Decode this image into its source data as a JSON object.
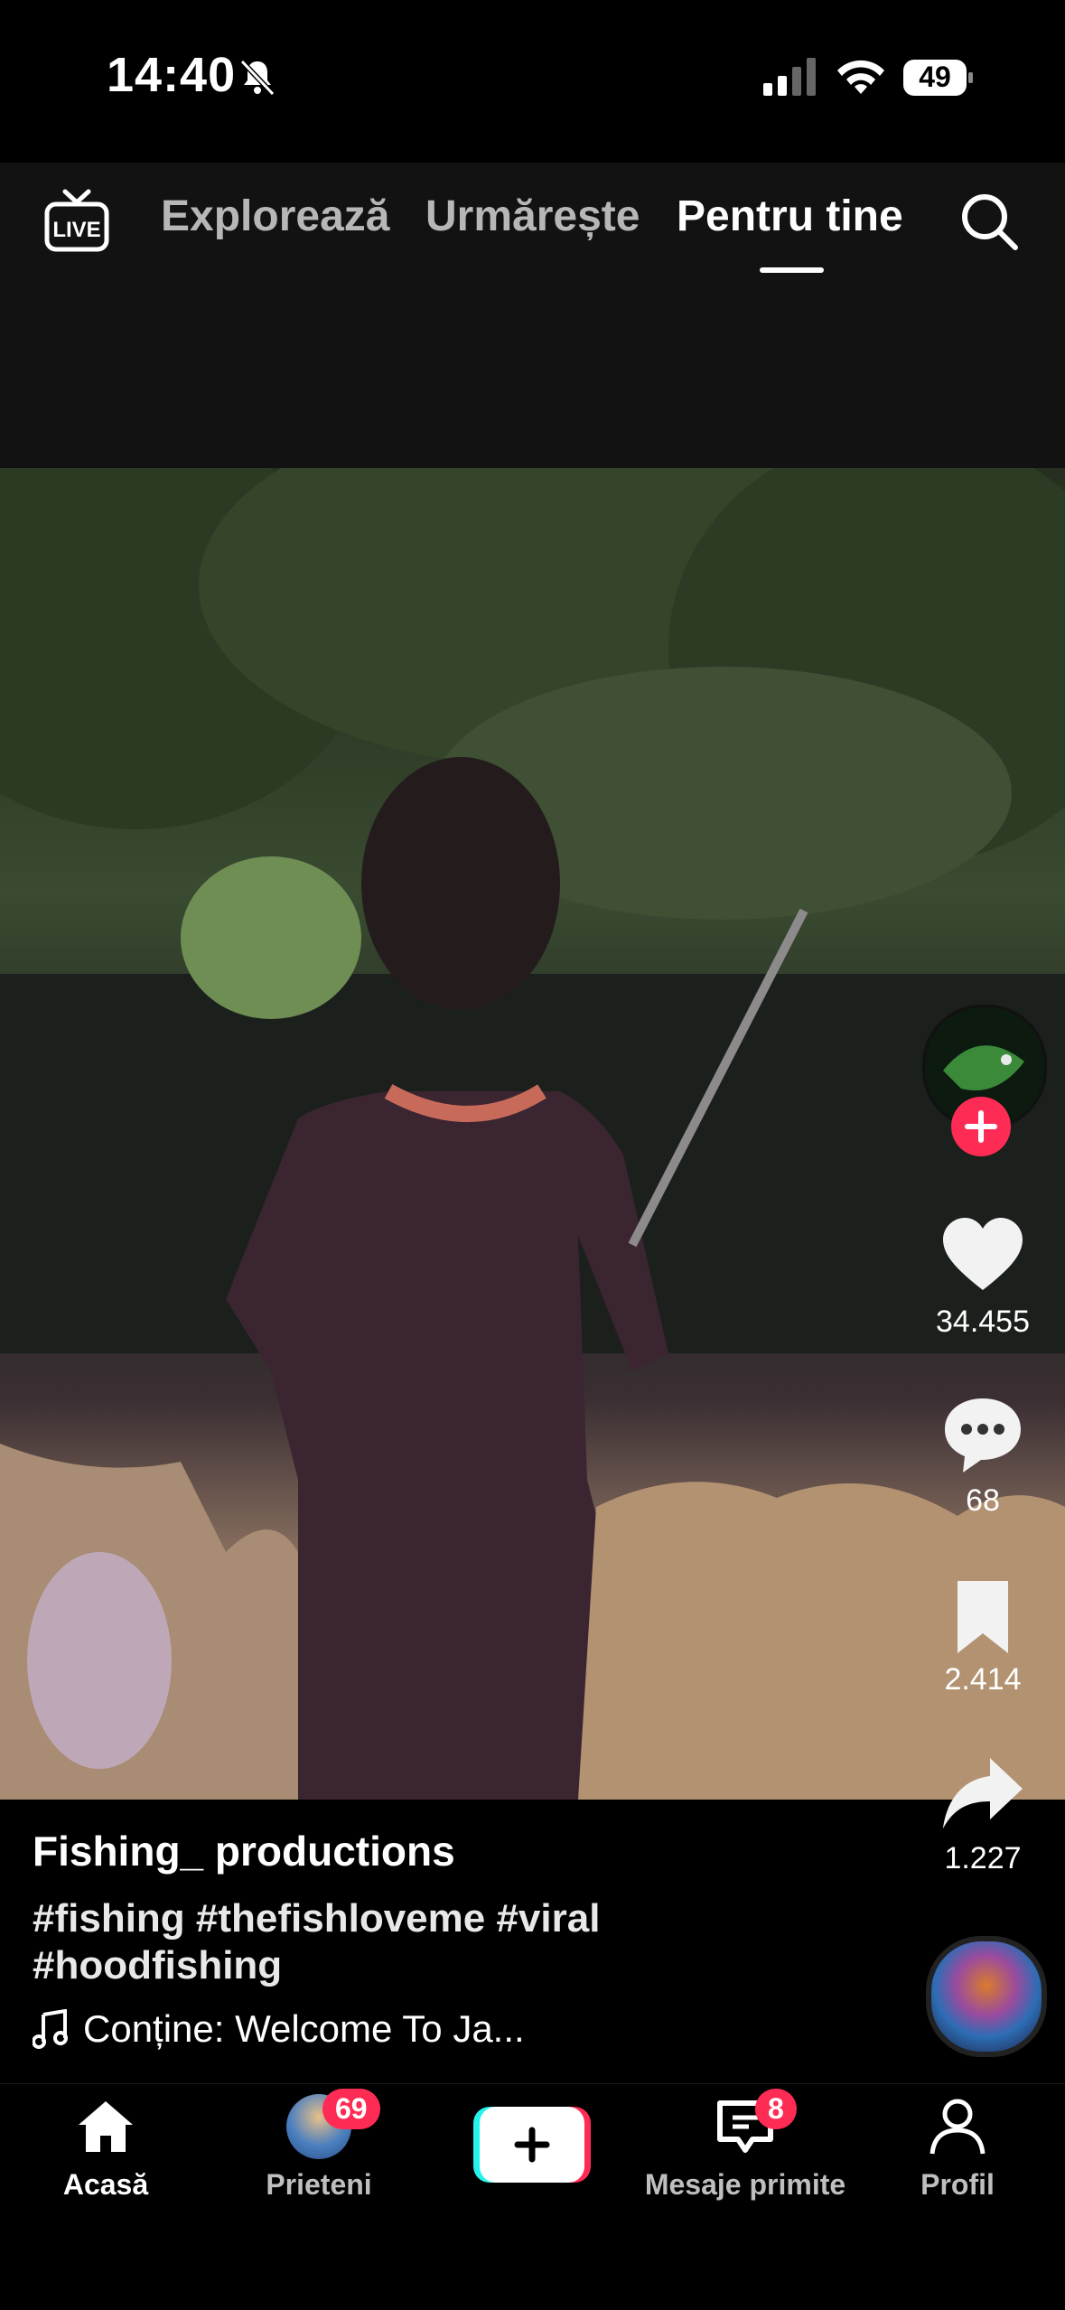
{
  "status_bar": {
    "time": "14:40",
    "battery": "49"
  },
  "top_nav": {
    "tabs": [
      {
        "label": "Explorează"
      },
      {
        "label": "Urmărește"
      },
      {
        "label": "Pentru tine"
      }
    ],
    "active_tab": "Pentru tine"
  },
  "actions": {
    "likes": "34.455",
    "comments": "68",
    "saves": "2.414",
    "shares": "1.227"
  },
  "post": {
    "author": "Fishing_ productions",
    "caption": "#fishing #thefishloveme #viral #hoodfishing",
    "music": "Conține: Welcome To Ja..."
  },
  "bottom_nav": {
    "home": "Acasă",
    "friends": "Prieteni",
    "friends_badge": "69",
    "inbox": "Mesaje primite",
    "inbox_badge": "8",
    "profile": "Profil"
  },
  "colors": {
    "accent": "#fe2c55",
    "cyan": "#25f4ee"
  }
}
